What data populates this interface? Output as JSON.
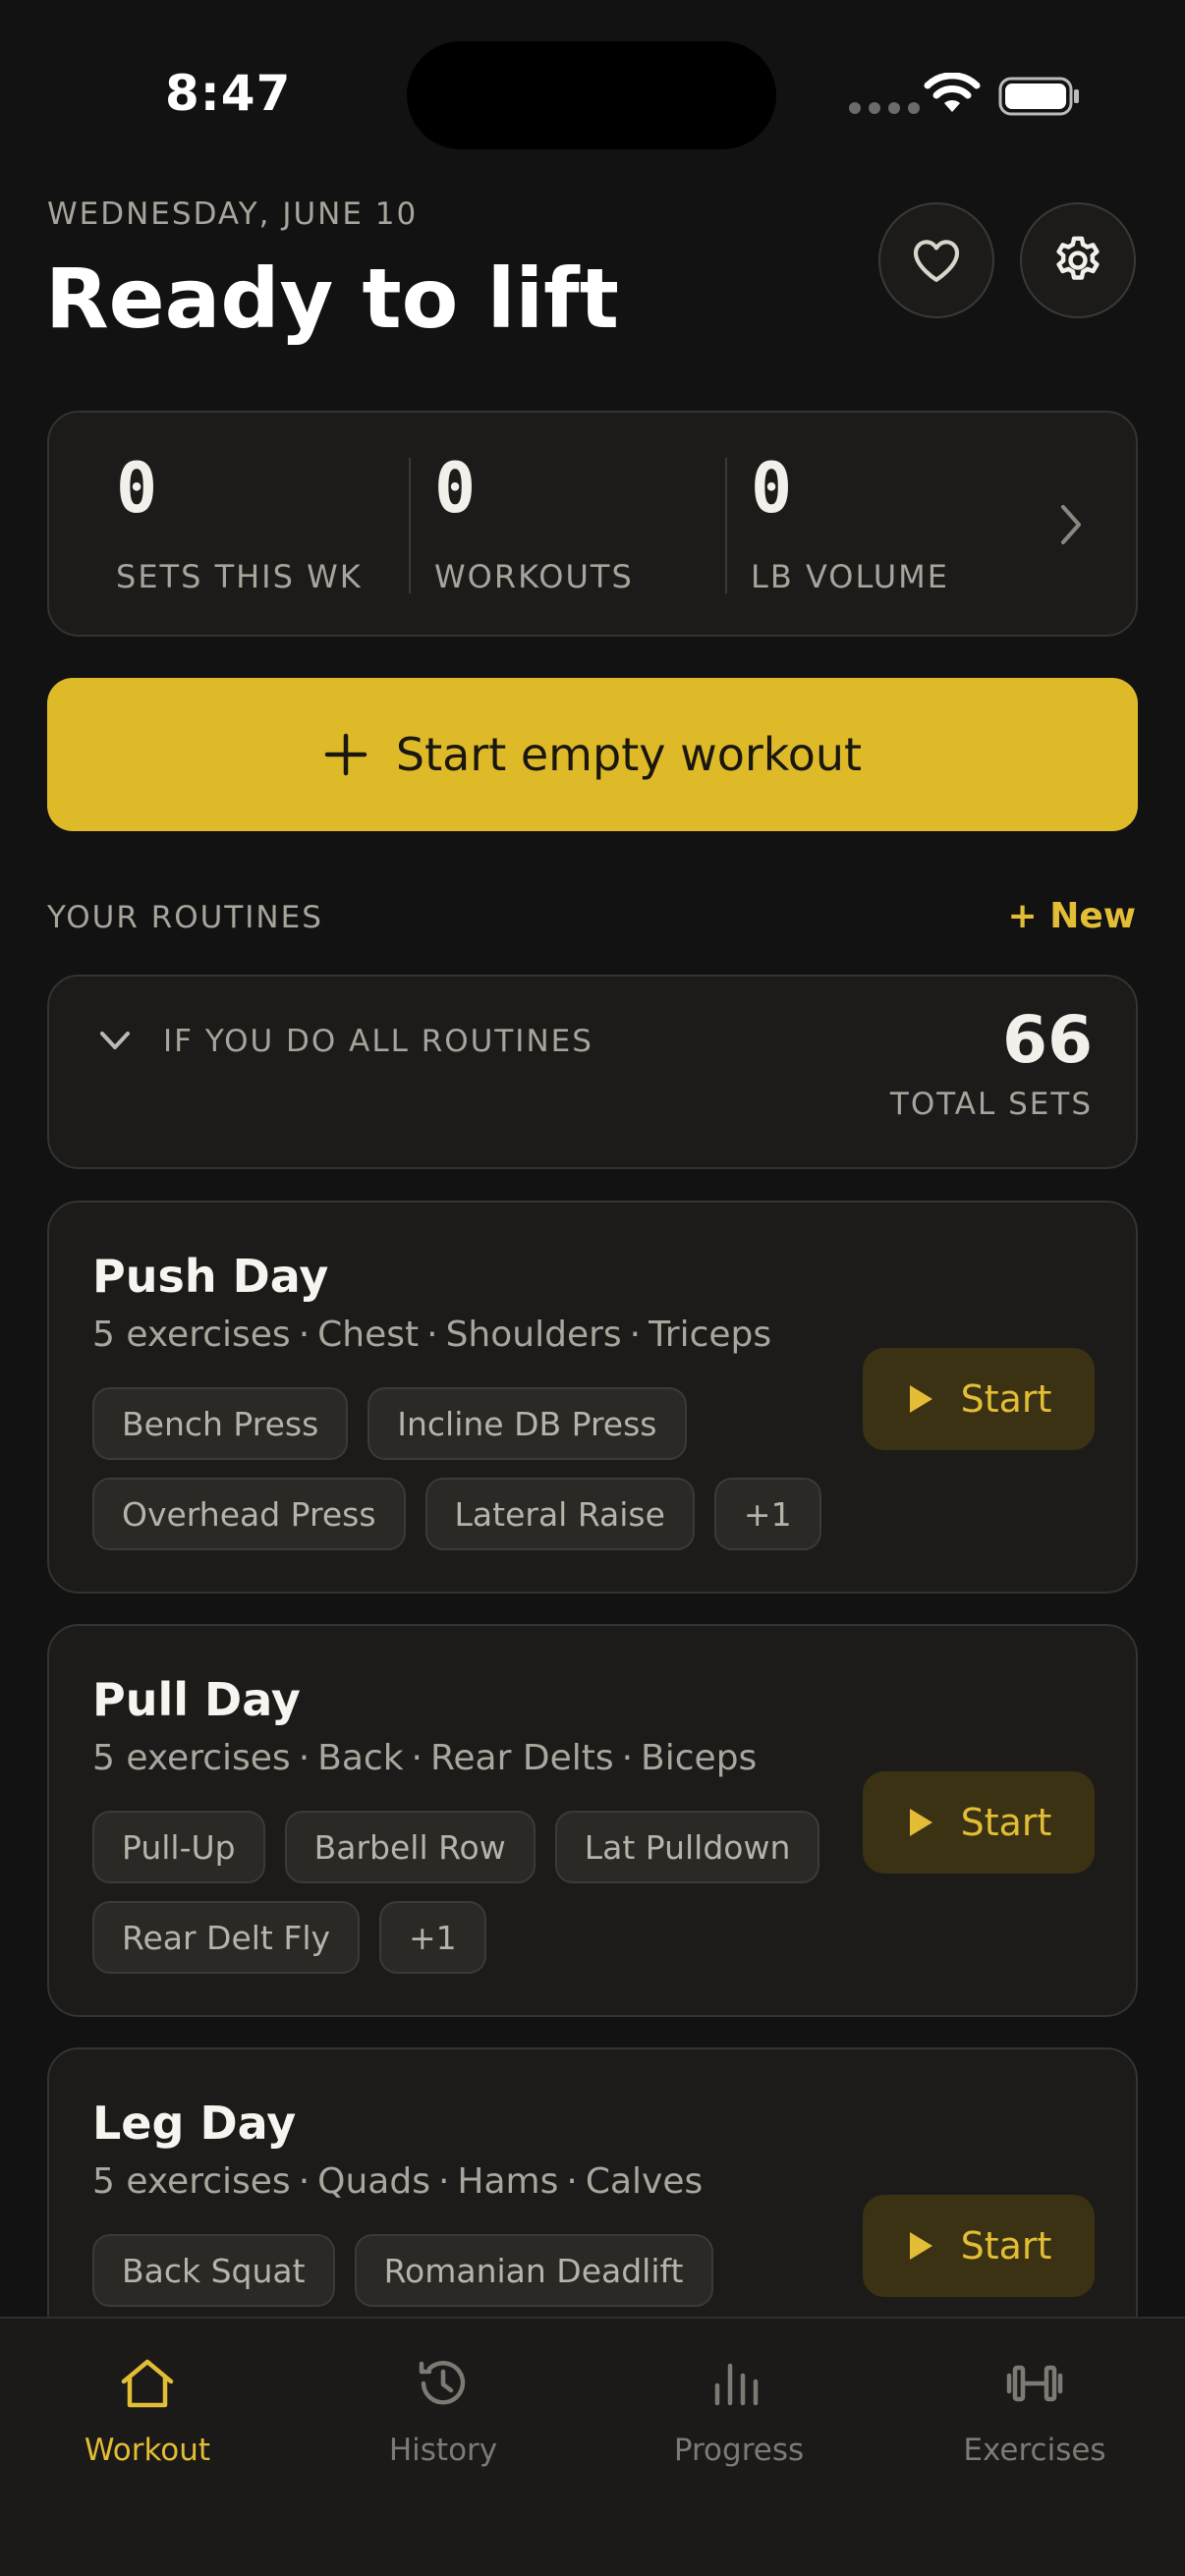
{
  "status_bar": {
    "time": "8:47"
  },
  "header": {
    "date": "WEDNESDAY, JUNE 10",
    "title": "Ready to lift",
    "favorite_icon": "heart-icon",
    "settings_icon": "gear-icon"
  },
  "stats": [
    {
      "value": "0",
      "label": "SETS THIS WK"
    },
    {
      "value": "0",
      "label": "WORKOUTS"
    },
    {
      "value": "0",
      "label": "LB VOLUME"
    }
  ],
  "start_empty": {
    "icon": "plus-icon",
    "label": "Start empty workout"
  },
  "routines_section": {
    "label": "YOUR ROUTINES",
    "new_label": "+ New"
  },
  "summary": {
    "label": "IF YOU DO ALL ROUTINES",
    "value": "66",
    "unit": "TOTAL SETS"
  },
  "routines": [
    {
      "name": "Push Day",
      "exercise_count": "5 exercises",
      "muscles": [
        "Chest",
        "Shoulders",
        "Triceps"
      ],
      "chip_rows": [
        [
          "Bench Press",
          "Incline DB Press"
        ],
        [
          "Overhead Press",
          "Lateral Raise",
          "+1"
        ]
      ],
      "start_label": "Start"
    },
    {
      "name": "Pull Day",
      "exercise_count": "5 exercises",
      "muscles": [
        "Back",
        "Rear Delts",
        "Biceps"
      ],
      "chip_rows": [
        [
          "Pull-Up",
          "Barbell Row",
          "Lat Pulldown"
        ],
        [
          "Rear Delt Fly",
          "+1"
        ]
      ],
      "start_label": "Start"
    },
    {
      "name": "Leg Day",
      "exercise_count": "5 exercises",
      "muscles": [
        "Quads",
        "Hams",
        "Calves"
      ],
      "chip_rows": [
        [
          "Back Squat",
          "Romanian Deadlift"
        ]
      ],
      "start_label": "Start"
    }
  ],
  "tabs": [
    {
      "label": "Workout",
      "icon": "home-icon",
      "active": true
    },
    {
      "label": "History",
      "icon": "history-icon",
      "active": false
    },
    {
      "label": "Progress",
      "icon": "bar-chart-icon",
      "active": false
    },
    {
      "label": "Exercises",
      "icon": "dumbbell-icon",
      "active": false
    }
  ],
  "colors": {
    "accent": "#dfba28",
    "background": "#121212",
    "card": "#1c1b19"
  }
}
